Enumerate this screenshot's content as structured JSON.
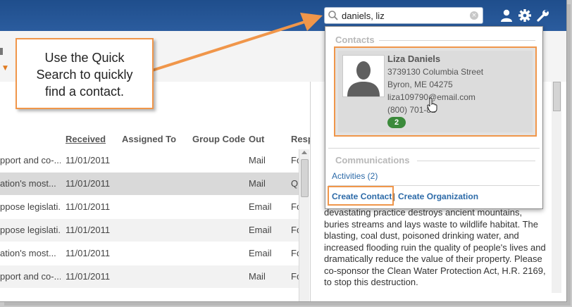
{
  "search": {
    "value": "daniels, liz",
    "clear_glyph": "×"
  },
  "header_icons": [
    "user-icon",
    "gear-icon",
    "wrench-icon"
  ],
  "table": {
    "columns": [
      "Received",
      "Assigned To",
      "Group Code",
      "Out",
      "Resp"
    ],
    "rows": [
      {
        "subject": "pport and co-...",
        "received": "11/01/2011",
        "out": "Mail",
        "resp": "Fo"
      },
      {
        "subject": "ation's most...",
        "received": "11/01/2011",
        "out": "Mail",
        "resp": "Q"
      },
      {
        "subject": "ppose legislati...",
        "received": "11/01/2011",
        "out": "Email",
        "resp": "Fo"
      },
      {
        "subject": "ppose legislati...",
        "received": "11/01/2011",
        "out": "Email",
        "resp": "Fo"
      },
      {
        "subject": "ation's most...",
        "received": "11/01/2011",
        "out": "Email",
        "resp": "Fo"
      },
      {
        "subject": "pport and co-...",
        "received": "11/01/2011",
        "out": "Mail",
        "resp": "Fo"
      }
    ]
  },
  "dropdown": {
    "contacts_title": "Contacts",
    "contact": {
      "name": "Liza Daniels",
      "street": "3739130 Columbia Street",
      "city": "Byron, ME 04275",
      "email": "liza109790@email.com",
      "phone": "(800) 701-81",
      "badge": "2"
    },
    "communications_title": "Communications",
    "activities": "Activities (2)",
    "create_contact": "Create Contact",
    "separator": "|",
    "create_org": "Create Organization"
  },
  "body_text": "devastating practice destroys ancient mountains, buries streams and lays waste to wildlife habitat. The blasting, coal dust, poisoned drinking water, and increased flooding ruin the quality of people's lives and dramatically reduce the value of their property. Please co-sponsor the Clean Water Protection Act, H.R. 2169, to stop this destruction.",
  "callout": "Use the Quick\nSearch to quickly\nfind a contact.",
  "colors": {
    "header": "#2b5c9e",
    "highlight": "#f0964a",
    "link": "#2c6aa8",
    "badge": "#3b8a3b"
  }
}
